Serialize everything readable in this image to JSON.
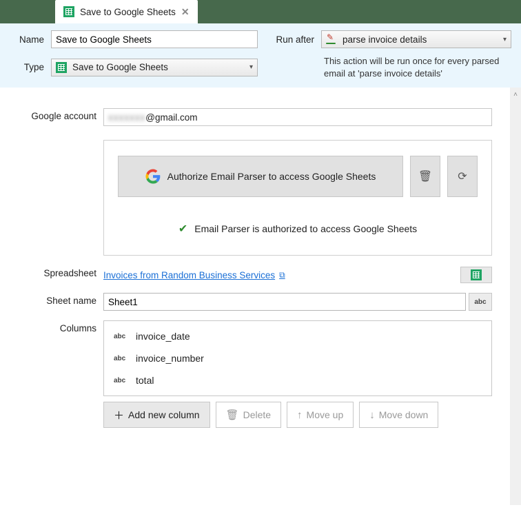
{
  "tab": {
    "title": "Save to Google Sheets"
  },
  "header": {
    "name_label": "Name",
    "name_value": "Save to Google Sheets",
    "type_label": "Type",
    "type_value": "Save to Google Sheets",
    "runafter_label": "Run after",
    "runafter_value": "parse invoice details",
    "help_text": "This action will be run once for every parsed email at 'parse invoice details'"
  },
  "account": {
    "label": "Google account",
    "value_suffix": "@gmail.com"
  },
  "auth": {
    "button_label": "Authorize Email Parser to access Google Sheets",
    "status_text": "Email Parser is authorized to access Google Sheets"
  },
  "spreadsheet": {
    "label": "Spreadsheet",
    "link_text": "Invoices from Random Business Services"
  },
  "sheetname": {
    "label": "Sheet name",
    "value": "Sheet1",
    "abc_label": "abc"
  },
  "columns": {
    "label": "Columns",
    "items": [
      {
        "name": "invoice_date"
      },
      {
        "name": "invoice_number"
      },
      {
        "name": "total"
      }
    ],
    "abc_label": "abc",
    "buttons": {
      "add": "Add new column",
      "delete": "Delete",
      "moveup": "Move up",
      "movedown": "Move down"
    }
  }
}
